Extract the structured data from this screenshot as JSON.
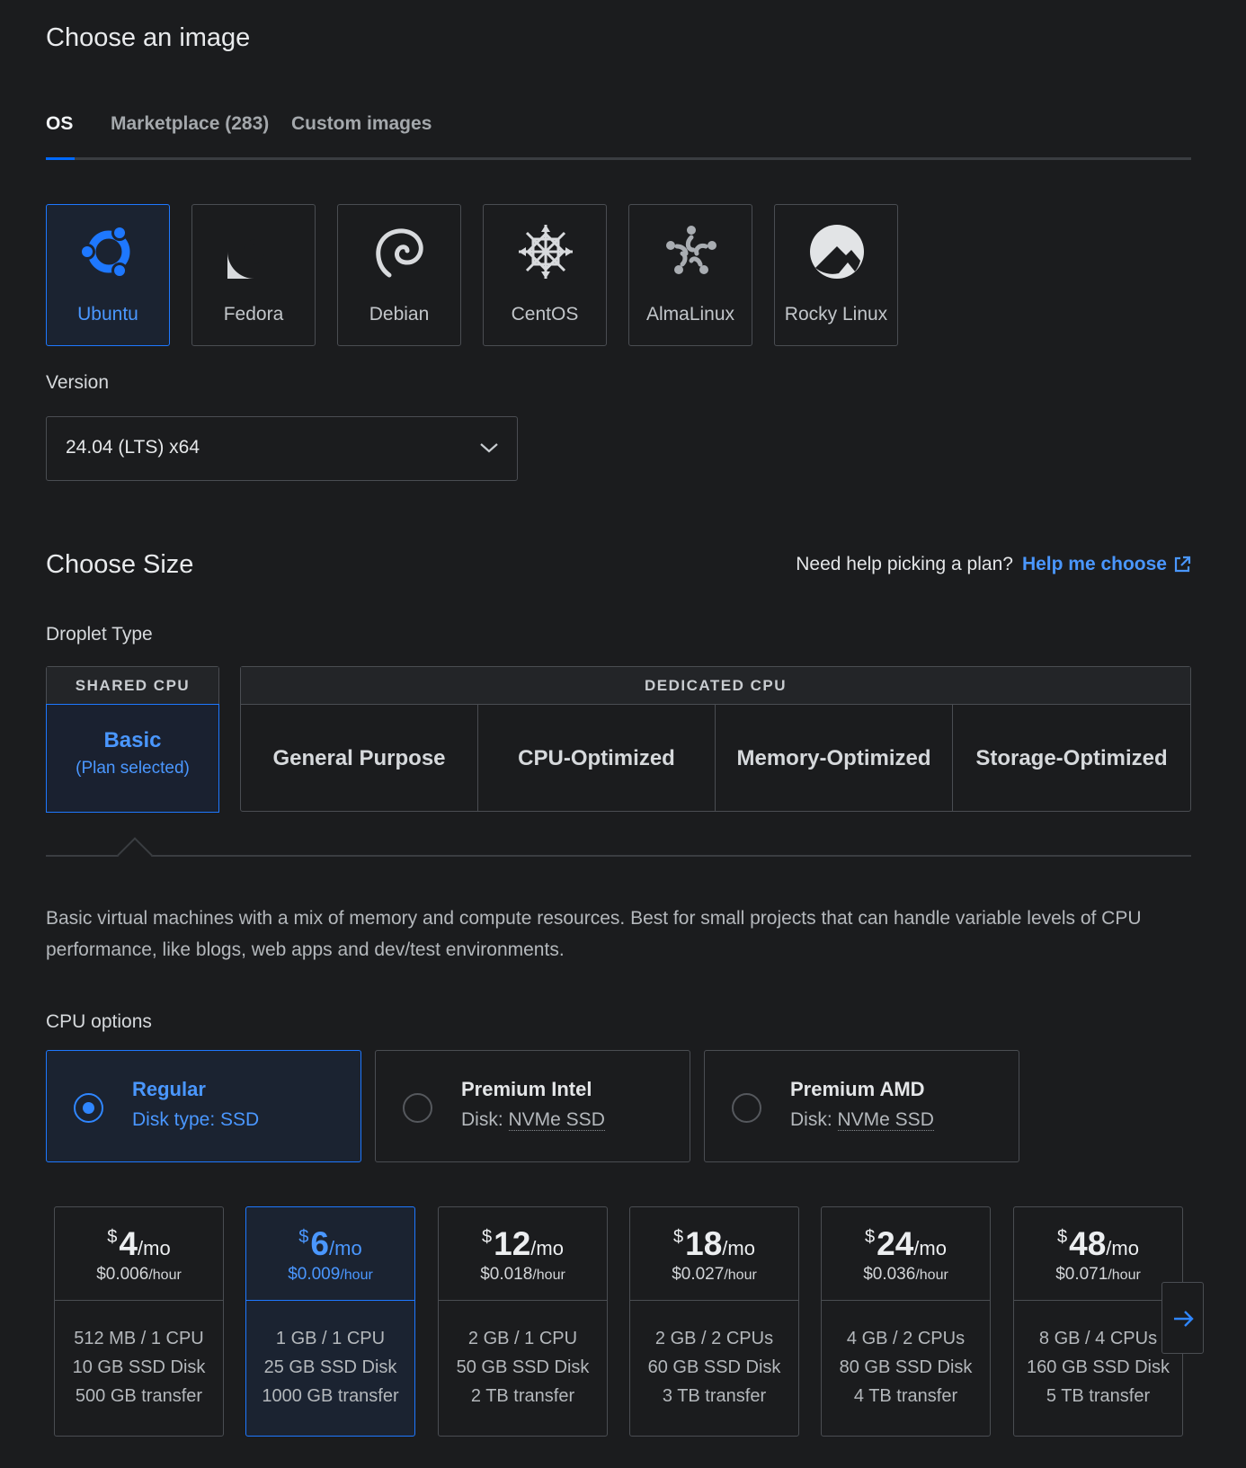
{
  "image_section": {
    "title": "Choose an image",
    "tabs": [
      {
        "label": "OS",
        "active": true
      },
      {
        "label": "Marketplace (283)",
        "active": false
      },
      {
        "label": "Custom images",
        "active": false
      }
    ],
    "os_options": [
      {
        "label": "Ubuntu",
        "icon": "ubuntu-icon",
        "selected": true
      },
      {
        "label": "Fedora",
        "icon": "fedora-icon",
        "selected": false
      },
      {
        "label": "Debian",
        "icon": "debian-icon",
        "selected": false
      },
      {
        "label": "CentOS",
        "icon": "centos-icon",
        "selected": false
      },
      {
        "label": "AlmaLinux",
        "icon": "almalinux-icon",
        "selected": false
      },
      {
        "label": "Rocky Linux",
        "icon": "rocky-linux-icon",
        "selected": false
      }
    ],
    "version_label": "Version",
    "version_value": "24.04 (LTS) x64"
  },
  "size_section": {
    "title": "Choose Size",
    "help_text": "Need help picking a plan?",
    "help_link": "Help me choose",
    "droplet_type_label": "Droplet Type",
    "shared_cpu_header": "SHARED CPU",
    "basic_label": "Basic",
    "basic_sub": "(Plan selected)",
    "dedicated_cpu_header": "DEDICATED CPU",
    "dedicated_types": [
      "General Purpose",
      "CPU-Optimized",
      "Memory-Optimized",
      "Storage-Optimized"
    ],
    "description": "Basic virtual machines with a mix of memory and compute resources. Best for small projects that can handle variable levels of CPU performance, like blogs, web apps and dev/test environments.",
    "cpu_options_label": "CPU options",
    "cpu_options": [
      {
        "title": "Regular",
        "sub_prefix": "Disk type: SSD",
        "sub_value": "",
        "selected": true
      },
      {
        "title": "Premium Intel",
        "sub_prefix": "Disk: ",
        "sub_value": "NVMe SSD",
        "selected": false
      },
      {
        "title": "Premium AMD",
        "sub_prefix": "Disk: ",
        "sub_value": "NVMe SSD",
        "selected": false
      }
    ],
    "plans": [
      {
        "currency": "$",
        "amount": "4",
        "period": "/mo",
        "hourly": "$0.006",
        "hourly_unit": "/hour",
        "spec1": "512 MB / 1 CPU",
        "spec2": "10 GB SSD Disk",
        "spec3": "500 GB transfer",
        "selected": false
      },
      {
        "currency": "$",
        "amount": "6",
        "period": "/mo",
        "hourly": "$0.009",
        "hourly_unit": "/hour",
        "spec1": "1 GB / 1 CPU",
        "spec2": "25 GB SSD Disk",
        "spec3": "1000 GB transfer",
        "selected": true
      },
      {
        "currency": "$",
        "amount": "12",
        "period": "/mo",
        "hourly": "$0.018",
        "hourly_unit": "/hour",
        "spec1": "2 GB / 1 CPU",
        "spec2": "50 GB SSD Disk",
        "spec3": "2 TB transfer",
        "selected": false
      },
      {
        "currency": "$",
        "amount": "18",
        "period": "/mo",
        "hourly": "$0.027",
        "hourly_unit": "/hour",
        "spec1": "2 GB / 2 CPUs",
        "spec2": "60 GB SSD Disk",
        "spec3": "3 TB transfer",
        "selected": false
      },
      {
        "currency": "$",
        "amount": "24",
        "period": "/mo",
        "hourly": "$0.036",
        "hourly_unit": "/hour",
        "spec1": "4 GB / 2 CPUs",
        "spec2": "80 GB SSD Disk",
        "spec3": "4 TB transfer",
        "selected": false
      },
      {
        "currency": "$",
        "amount": "48",
        "period": "/mo",
        "hourly": "$0.071",
        "hourly_unit": "/hour",
        "spec1": "8 GB / 4 CPUs",
        "spec2": "160 GB SSD Disk",
        "spec3": "5 TB transfer",
        "selected": false
      }
    ],
    "next_icon": "arrow-right-icon"
  },
  "colors": {
    "background": "#1b1c1e",
    "accent": "#0069ff",
    "accent_text": "#4a97ff",
    "border": "#4a4d52"
  }
}
